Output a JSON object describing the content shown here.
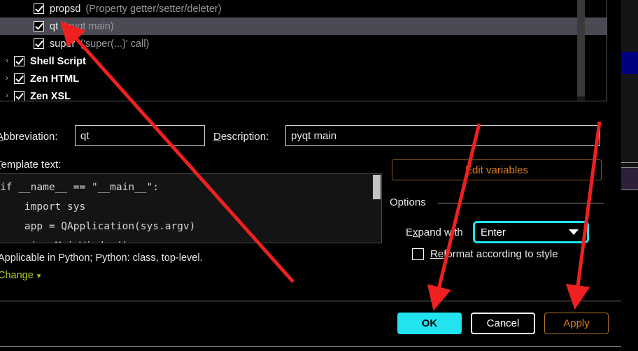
{
  "list": {
    "rows": [
      {
        "twisty": "",
        "checked": true,
        "name": "propsd",
        "desc": "(Property getter/setter/deleter)",
        "bold": false,
        "indent": true,
        "selected": false
      },
      {
        "twisty": "",
        "checked": true,
        "name": "qt",
        "desc": "(pyqt main)",
        "bold": false,
        "indent": true,
        "selected": true
      },
      {
        "twisty": "",
        "checked": true,
        "name": "super",
        "desc": "('super(...)' call)",
        "bold": false,
        "indent": true,
        "selected": false
      },
      {
        "twisty": "›",
        "checked": true,
        "name": "Shell Script",
        "desc": "",
        "bold": true,
        "indent": false,
        "selected": false
      },
      {
        "twisty": "›",
        "checked": true,
        "name": "Zen HTML",
        "desc": "",
        "bold": true,
        "indent": false,
        "selected": false
      },
      {
        "twisty": "›",
        "checked": true,
        "name": "Zen XSL",
        "desc": "",
        "bold": true,
        "indent": false,
        "selected": false
      }
    ]
  },
  "form": {
    "abbreviation_label_pre": "A",
    "abbreviation_label_post": "bbreviation:",
    "abbreviation_value": "qt",
    "description_label_pre": "D",
    "description_label_post": "escription:",
    "description_value": "pyqt main",
    "template_label_pre": "T",
    "template_label_post": "emplate text:",
    "template_text": "if __name__ == \"__main__\":\n    import sys\n    app = QApplication(sys.argv)\n    ui = MainWindow()",
    "applicable_text": "Applicable in Python; Python: class, top-level.",
    "change_label": "Change",
    "change_chevron": "chevron-down-icon"
  },
  "right_panel": {
    "edit_variables_label": "Edit variables",
    "options_label": "Options",
    "expand_with_label_pre": "E",
    "expand_with_label_mid": "x",
    "expand_with_label_post": "pand with",
    "expand_with_value": "Enter",
    "reformat_label_pre": "Re",
    "reformat_label_post": "format according to style",
    "reformat_checked": false
  },
  "footer": {
    "ok_label": "OK",
    "cancel_label": "Cancel",
    "apply_label": "Apply"
  },
  "colors": {
    "accent_cyan": "#22e3f0",
    "accent_orange": "#e07b18",
    "link_green": "#b5cc2a",
    "annotation_red": "#f02020",
    "selection": "#4a4a55"
  }
}
